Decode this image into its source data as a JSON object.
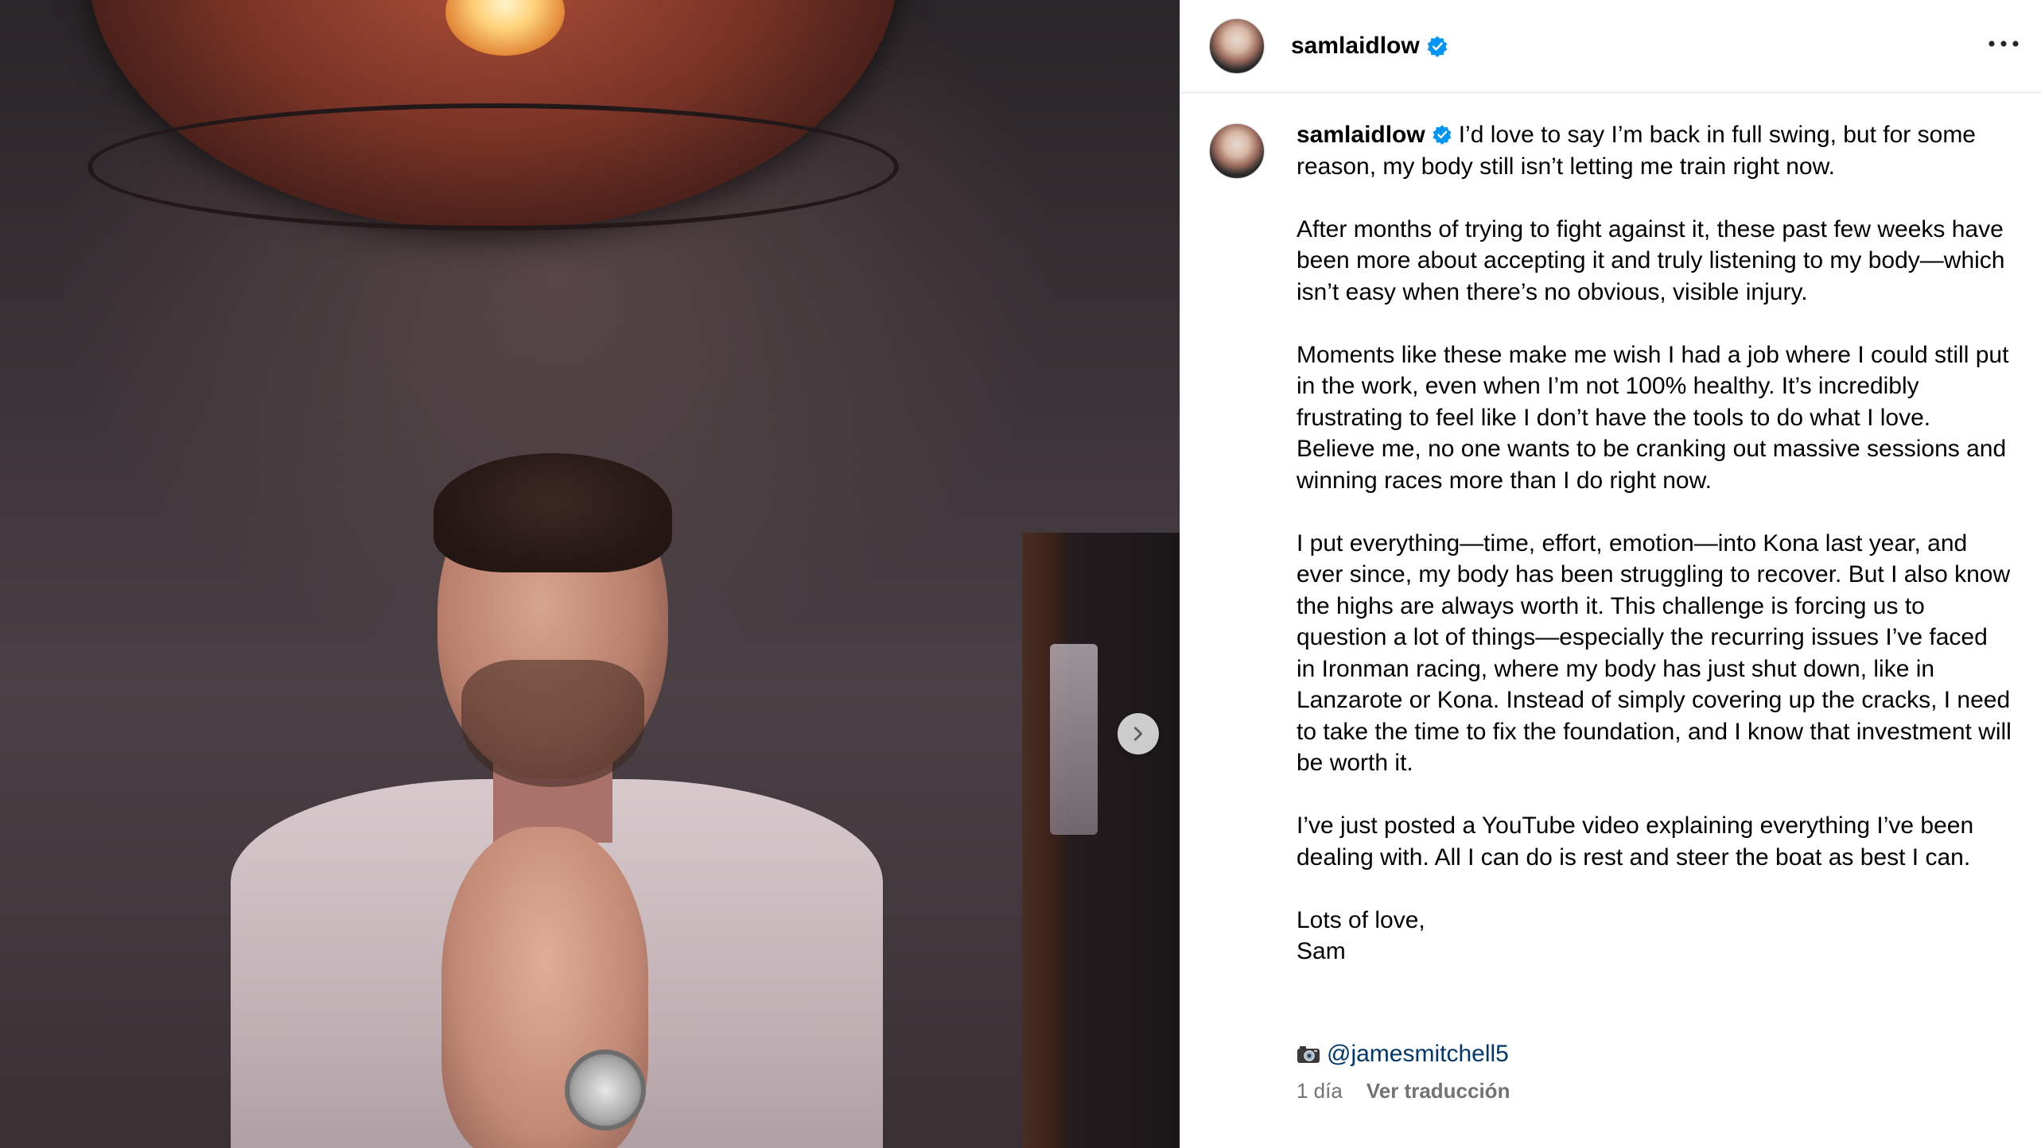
{
  "post": {
    "username": "samlaidlow",
    "verified": true,
    "more_icon": "more-horizontal-icon",
    "next_icon": "chevron-right-icon"
  },
  "caption": {
    "username": "samlaidlow",
    "first_paragraph": "I’d love to say I’m back in full swing, but for some reason, my body still isn’t letting me train right now.",
    "paragraph_2": "After months of trying to fight against it, these past few weeks have been more about accepting it and truly listening to my body—which isn’t easy when there’s no obvious, visible injury.",
    "paragraph_3": "Moments like these make me wish I had a job where I could still put in the work, even when I’m not 100% healthy. It’s incredibly frustrating to feel like I don’t have the tools to do what I love. Believe me, no one wants to be cranking out massive sessions and winning races more than I do right now.",
    "paragraph_4": "I put everything—time, effort, emotion—into Kona last year, and ever since, my body has been struggling to recover. But I also know the highs are always worth it. This challenge is forcing us to question a lot of things—especially the recurring issues I’ve faced in Ironman racing, where my body has just shut down, like in Lanzarote or Kona. Instead of simply covering up the cracks, I need to take the time to fix the foundation, and I know that investment will be worth it.",
    "paragraph_5": "I’ve just posted a YouTube video explaining everything I’ve been dealing with. All I can do is rest and steer the boat as best I can.",
    "signoff_1": "Lots of love,",
    "signoff_2": "Sam",
    "credit_icon": "camera-icon",
    "credit_mention": "@jamesmitchell5"
  },
  "meta": {
    "time_ago": "1 día",
    "translate_label": "Ver traducción"
  },
  "colors": {
    "verified_badge": "#0095f6",
    "mention_link": "#00376b",
    "meta_text": "#737373"
  }
}
